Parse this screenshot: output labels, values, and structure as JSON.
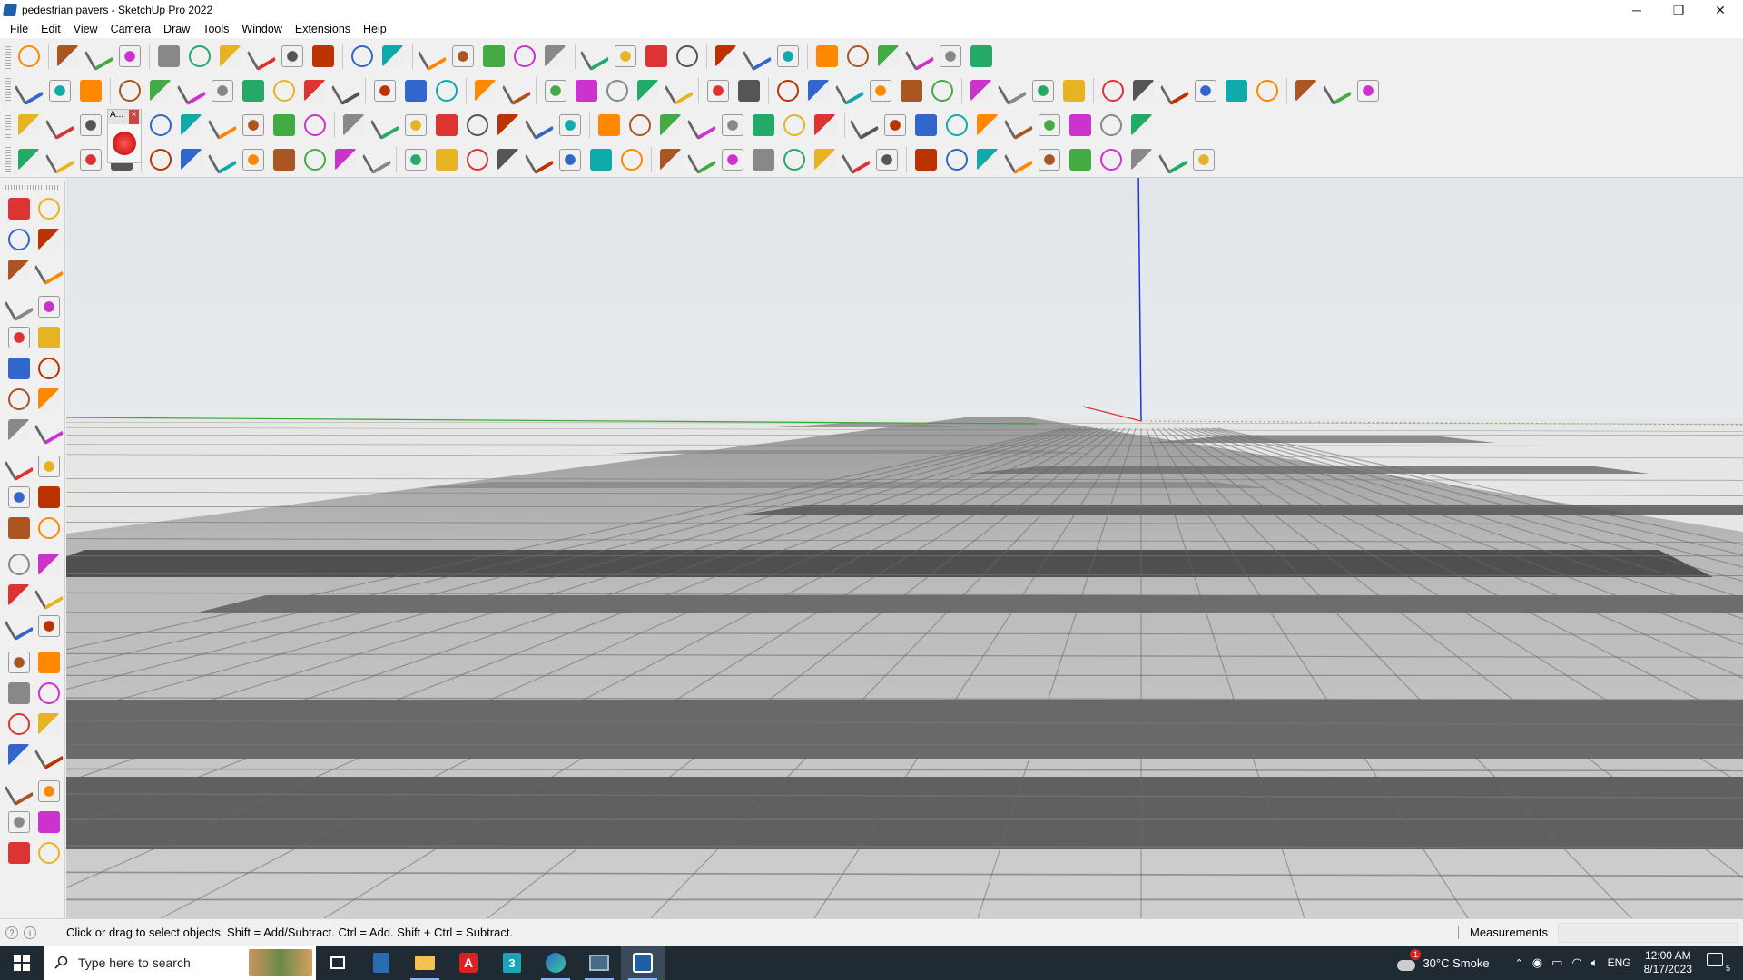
{
  "window": {
    "title": "pedestrian pavers - SketchUp Pro 2022",
    "controls": {
      "minimize": "─",
      "maximize": "❐",
      "close": "✕"
    }
  },
  "menu": [
    "File",
    "Edit",
    "View",
    "Camera",
    "Draw",
    "Tools",
    "Window",
    "Extensions",
    "Help"
  ],
  "toolbar_popup": {
    "label": "A...",
    "close": "×"
  },
  "status": {
    "message": "Click or drag to select objects. Shift = Add/Subtract. Ctrl = Add. Shift + Ctrl = Subtract.",
    "measurements_label": "Measurements",
    "measurements_value": ""
  },
  "taskbar": {
    "search_placeholder": "Type here to search",
    "weather": "30°C  Smoke",
    "language": "ENG",
    "time": "12:00 AM",
    "date": "8/17/2023",
    "notification_count": "5",
    "weather_alert": "1"
  },
  "colors": {
    "axis_blue": "#2233dd",
    "axis_green": "#33aa33",
    "axis_red": "#dd3333",
    "taskbar_bg": "#1f2a33",
    "accent": "#7fb9ff"
  }
}
